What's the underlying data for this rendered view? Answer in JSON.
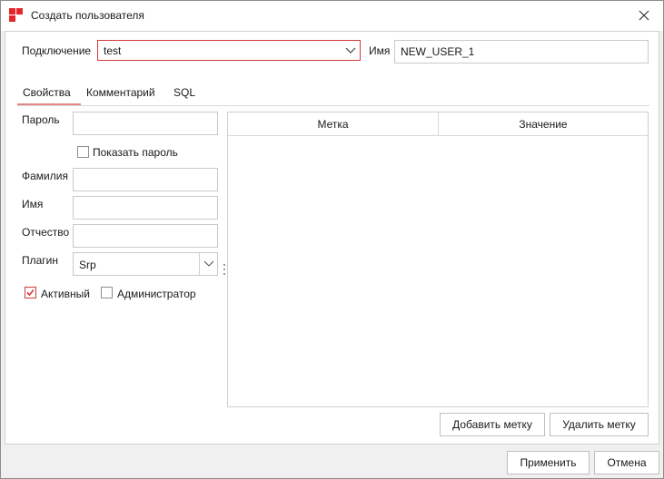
{
  "window": {
    "title": "Создать пользователя",
    "icon": "app-logo-icon",
    "accent_color": "#e3262b"
  },
  "connection": {
    "label": "Подключение",
    "value": "test",
    "name_label": "Имя",
    "name_value": "NEW_USER_1"
  },
  "tabs": [
    {
      "label": "Свойства",
      "active": true
    },
    {
      "label": "Комментарий",
      "active": false
    },
    {
      "label": "SQL",
      "active": false
    }
  ],
  "properties": {
    "password_label": "Пароль",
    "password_value": "",
    "show_password_label": "Показать пароль",
    "show_password_checked": false,
    "lastname_label": "Фамилия",
    "lastname_value": "",
    "firstname_label": "Имя",
    "firstname_value": "",
    "middlename_label": "Отчество",
    "middlename_value": "",
    "plugin_label": "Плагин",
    "plugin_value": "Srp",
    "active_label": "Активный",
    "active_checked": true,
    "admin_label": "Администратор",
    "admin_checked": false
  },
  "tags_table": {
    "columns": [
      "Метка",
      "Значение"
    ],
    "rows": []
  },
  "buttons": {
    "add_tag": "Добавить метку",
    "delete_tag": "Удалить метку",
    "apply": "Применить",
    "cancel": "Отмена"
  }
}
